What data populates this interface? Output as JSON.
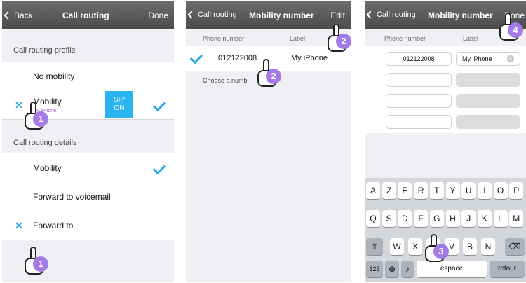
{
  "screen1": {
    "nav": {
      "back": "Back",
      "title": "Call routing",
      "done": "Done"
    },
    "profile_label": "Call routing profile",
    "no_mobility": "No mobility",
    "mobility": "Mobility",
    "mobility_sub": "My iPhone",
    "sip_line1": "SIP",
    "sip_line2": "ON",
    "details_label": "Call routing details",
    "detail_mobility": "Mobility",
    "forward_voicemail": "Forward to voicemail",
    "forward_to": "Forward to",
    "hand_a": "1",
    "hand_b": "1"
  },
  "screen2": {
    "nav": {
      "back": "Call routing",
      "title": "Mobility number",
      "edit": "Edit"
    },
    "col_phone": "Phone number",
    "col_label": "Label",
    "row_number": "012122008",
    "row_label": "My iPhone",
    "choose": "Choose a numb",
    "hand_a": "2",
    "hand_b": "2"
  },
  "screen3": {
    "nav": {
      "back": "Call routing",
      "title": "Mobility number",
      "done": "Done"
    },
    "col_phone": "Phone number",
    "col_label": "Label",
    "field_number": "012122008",
    "field_label": "My iPhone",
    "keys_row1": [
      "A",
      "Z",
      "E",
      "R",
      "T",
      "Y",
      "U",
      "I",
      "O",
      "P"
    ],
    "keys_row2": [
      "Q",
      "S",
      "D",
      "F",
      "G",
      "H",
      "J",
      "K",
      "L",
      "M"
    ],
    "keys_row3": [
      "W",
      "X",
      "C",
      "V",
      "B",
      "N"
    ],
    "key_123": "123",
    "key_space": "espace",
    "key_return": "retour",
    "hand_a": "4",
    "hand_b": "3"
  },
  "colors": {
    "accent": "#2aa8e6",
    "sip": "#29b4f0",
    "hand_badge": "#a37ae6",
    "subtitle": "#9b50d6"
  }
}
